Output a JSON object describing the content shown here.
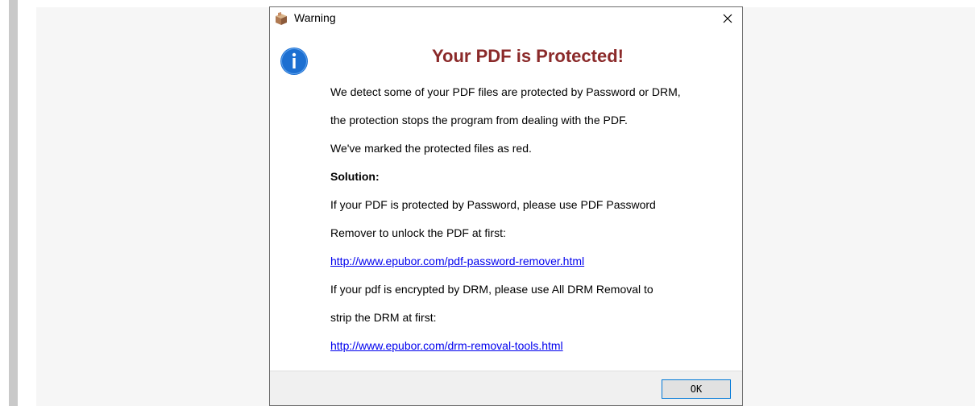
{
  "dialog": {
    "title": "Warning",
    "heading": "Your PDF is Protected!",
    "lines": [
      "We detect some of your PDF files are protected by Password or DRM,",
      "the protection stops the program from dealing with the PDF.",
      "We've marked the protected files as red."
    ],
    "solution_label": "Solution:",
    "password_lines": [
      "If your PDF is protected by Password, please use PDF Password",
      "Remover to unlock the PDF at first:"
    ],
    "password_link": "http://www.epubor.com/pdf-password-remover.html",
    "drm_lines": [
      "If your pdf is encrypted by DRM, please use All DRM Removal to",
      "strip the DRM at first:"
    ],
    "drm_link": "http://www.epubor.com/drm-removal-tools.html",
    "ok_label": "OK"
  },
  "icons": {
    "app": "app-box-icon",
    "close": "close-icon",
    "info": "info-icon"
  },
  "colors": {
    "heading": "#8b2a2a",
    "link": "#0000ee",
    "info_icon": "#1c6fd1",
    "button_border": "#0078d7"
  }
}
